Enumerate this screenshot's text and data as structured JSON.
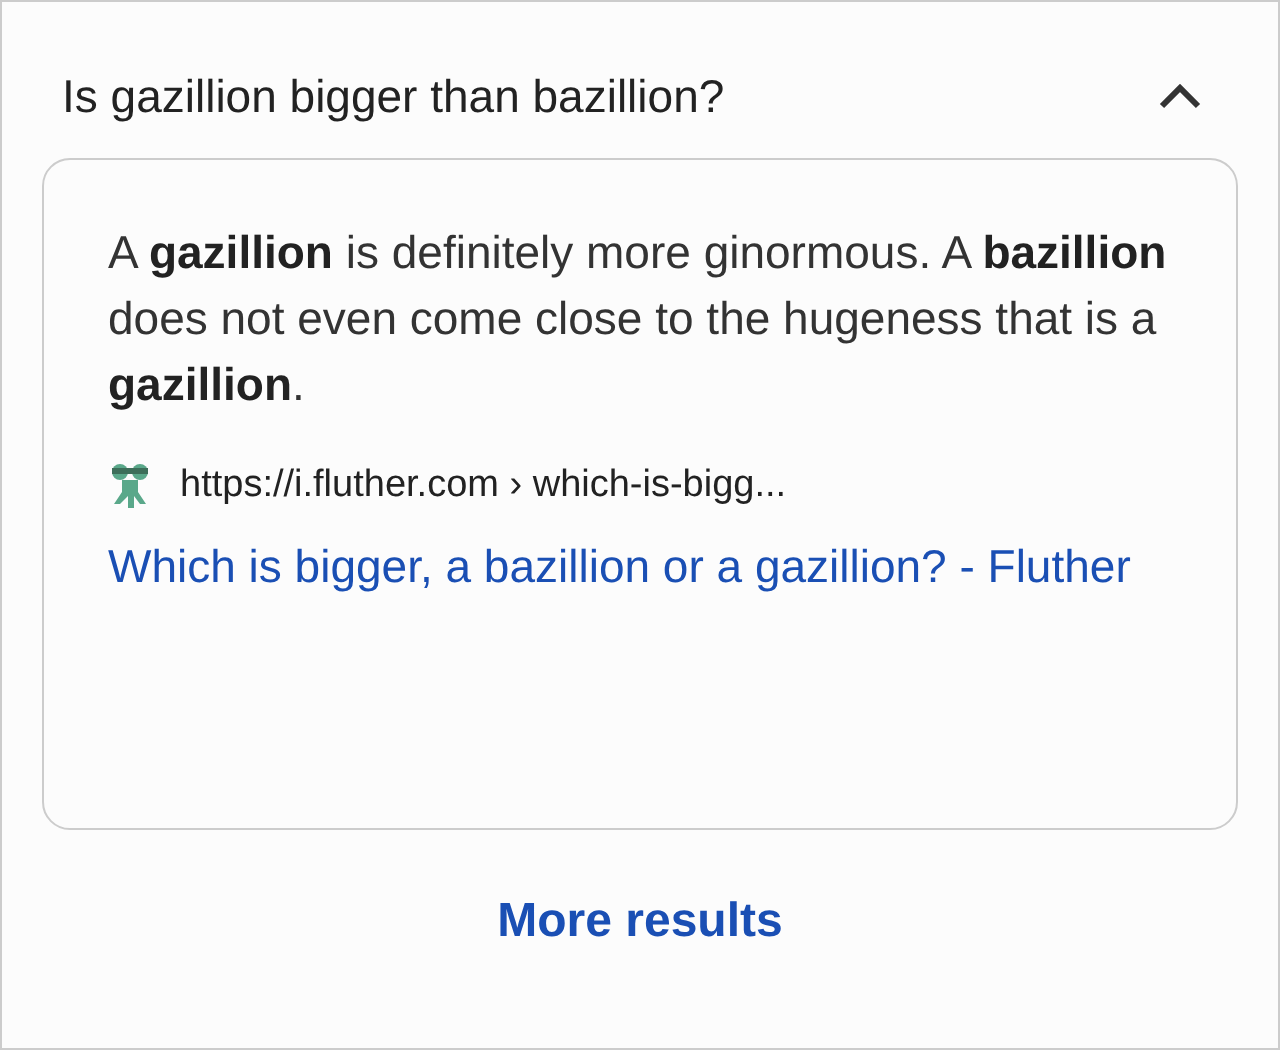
{
  "question": {
    "text": "Is gazillion bigger than bazillion?",
    "expanded": true
  },
  "answer": {
    "snippet": "A **gazillion** is definitely more ginormous. A **bazillion** does not even come close to the hugeness that is a **gazillion**.",
    "url": "https://i.fluther.com › which-is-bigg...",
    "link": "Which is bigger, a bazillion or a gazillion? - Fluther"
  },
  "more_button": "More results"
}
